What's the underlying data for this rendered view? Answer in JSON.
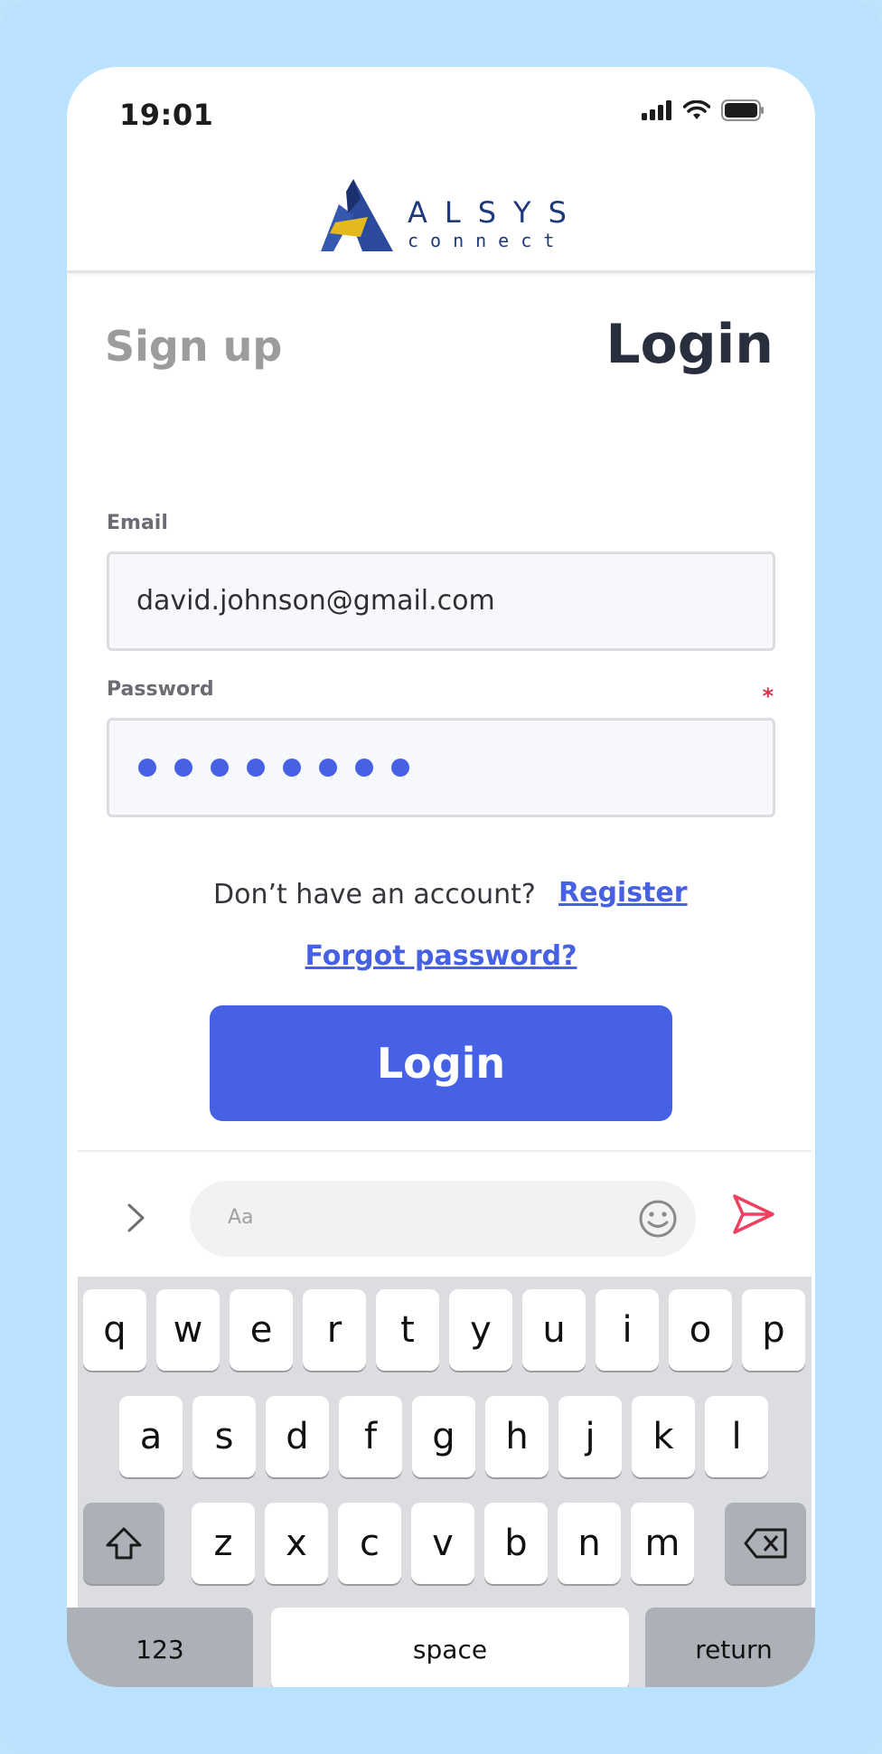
{
  "status": {
    "time": "19:01"
  },
  "logo": {
    "word1": "ALSYS",
    "word2": "connect"
  },
  "tabs": {
    "signup": "Sign up",
    "login": "Login"
  },
  "email": {
    "label": "Email",
    "value": "david.johnson@gmail.com"
  },
  "password": {
    "label": "Password",
    "required_mark": "*",
    "masked_length": 8
  },
  "links": {
    "no_account": "Don’t have an account?",
    "register": "Register",
    "forgot": "Forgot password?"
  },
  "login_button": "Login",
  "message_bar": {
    "placeholder": "Aa"
  },
  "keyboard": {
    "row1": [
      "q",
      "w",
      "e",
      "r",
      "t",
      "y",
      "u",
      "i",
      "o",
      "p"
    ],
    "row2": [
      "a",
      "s",
      "d",
      "f",
      "g",
      "h",
      "j",
      "k",
      "l"
    ],
    "row3": [
      "z",
      "x",
      "c",
      "v",
      "b",
      "n",
      "m"
    ],
    "numbers": "123",
    "space": "space",
    "return": "return"
  },
  "colors": {
    "accent": "#4761e4",
    "background": "#bae1fd",
    "required": "#e0334e",
    "send": "#ee4060"
  }
}
